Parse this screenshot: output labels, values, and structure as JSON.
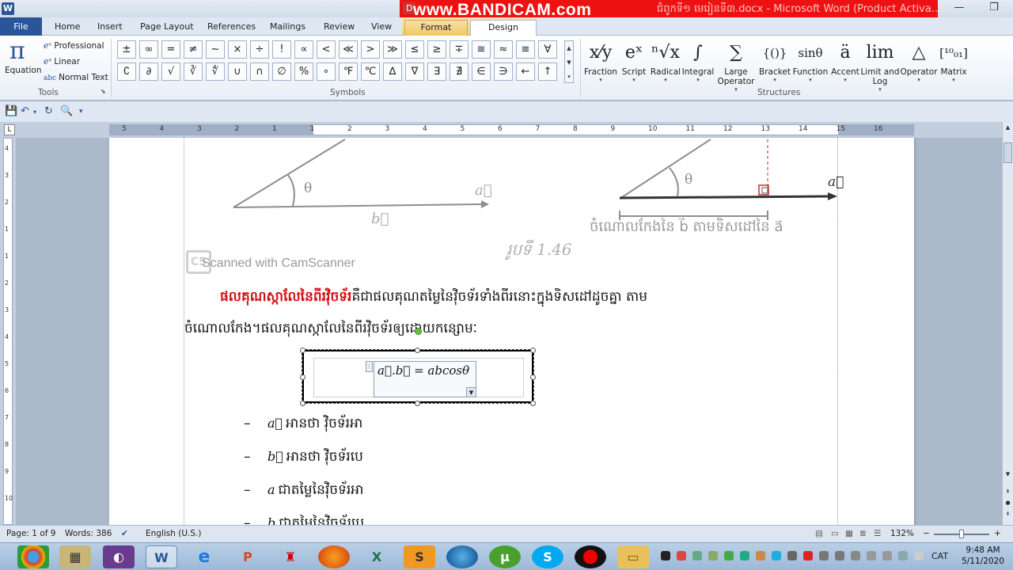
{
  "window": {
    "title": "ជំពូកទី១ មេរៀនទី៣.docx - Microsoft Word (Product Activa...",
    "doc_prefix": "D",
    "watermark": "www.BANDICAM.com",
    "minimize": "—",
    "restore": "❐"
  },
  "tabs": {
    "file": "File",
    "home": "Home",
    "insert": "Insert",
    "page_layout": "Page Layout",
    "references": "References",
    "mailings": "Mailings",
    "review": "Review",
    "view": "View",
    "format": "Format",
    "design": "Design"
  },
  "ribbon": {
    "tools": {
      "equation": "Equation",
      "professional": "Professional",
      "linear": "Linear",
      "normal_text": "Normal Text",
      "group": "Tools"
    },
    "symbols": {
      "group": "Symbols",
      "row1": [
        "±",
        "∞",
        "=",
        "≠",
        "~",
        "×",
        "÷",
        "!",
        "∝",
        "<",
        "≪",
        ">",
        "≫",
        "≤",
        "≥",
        "∓",
        "≅",
        "≈",
        "≡",
        "∀"
      ],
      "row2": [
        "∁",
        "∂",
        "√",
        "∛",
        "∜",
        "∪",
        "∩",
        "∅",
        "%",
        "∘",
        "℉",
        "℃",
        "∆",
        "∇",
        "∃",
        "∄",
        "∈",
        "∋",
        "←",
        "↑"
      ]
    },
    "structures": {
      "group": "Structures",
      "items": [
        {
          "glyph": "x⁄y",
          "label": "Fraction"
        },
        {
          "glyph": "eˣ",
          "label": "Script"
        },
        {
          "glyph": "ⁿ√x",
          "label": "Radical"
        },
        {
          "glyph": "∫",
          "label": "Integral"
        },
        {
          "glyph": "∑",
          "label": "Large Operator"
        },
        {
          "glyph": "{()}",
          "label": "Bracket"
        },
        {
          "glyph": "sinθ",
          "label": "Function"
        },
        {
          "glyph": "ä",
          "label": "Accent"
        },
        {
          "glyph": "lim",
          "label": "Limit and Log"
        },
        {
          "glyph": "△",
          "label": "Operator"
        },
        {
          "glyph": "[¹⁰₀₁]",
          "label": "Matrix"
        }
      ]
    }
  },
  "ruler": {
    "numbers": [
      "5",
      "4",
      "3",
      "2",
      "1",
      "1",
      "2",
      "3",
      "4",
      "5",
      "6",
      "7",
      "8",
      "9",
      "10",
      "11",
      "12",
      "13",
      "14",
      "15",
      "16"
    ],
    "vnumbers": [
      "4",
      "3",
      "2",
      "1",
      "1",
      "2",
      "3",
      "4",
      "5",
      "6",
      "7",
      "8",
      "9",
      "10"
    ]
  },
  "document": {
    "theta": "θ",
    "vec_a": "a⃗",
    "vec_b": "b⃗",
    "projection_caption": "ចំណោលកែងនៃ b⃗ តាមទិសដៅនៃ a⃗",
    "figure_caption": "រូបទី 1.46",
    "scanned": "Scanned with CamScanner",
    "cs_logo": "CS",
    "definition_title": "ផលគុណស្កាលែនៃពីរវ៉ិចទ័រ",
    "definition_text1": "គឺជាផលគុណតម្លៃនៃវ៉ិចទ័រទាំងពីរនោះក្នុងទិសដៅដូចគ្នា  តាម",
    "definition_text2": "ចំណោលកែង។ផលគុណស្កាលែនៃពីរវ៉ិចទ័រឲ្យដោយកន្សោមៈ",
    "equation": "a⃗.b⃗ = abcosθ",
    "bullets": [
      {
        "var": "a⃗",
        "text": "អានថា វ៉ិចទ័រអា"
      },
      {
        "var": "b⃗",
        "text": "អានថា វ៉ិចទ័របេ"
      },
      {
        "var": "a",
        "text": "ជាតម្លៃនៃវ៉ិចទ័រអា"
      },
      {
        "var": "b",
        "text": "ជាតម្លៃនៃវ៉ិចទ័របេ"
      }
    ]
  },
  "status": {
    "page": "Page: 1 of 9",
    "words": "Words: 386",
    "language": "English (U.S.)",
    "zoom": "132%"
  },
  "taskbar": {
    "language": "CAT",
    "time": "9:48 AM",
    "date": "5/11/2020"
  }
}
